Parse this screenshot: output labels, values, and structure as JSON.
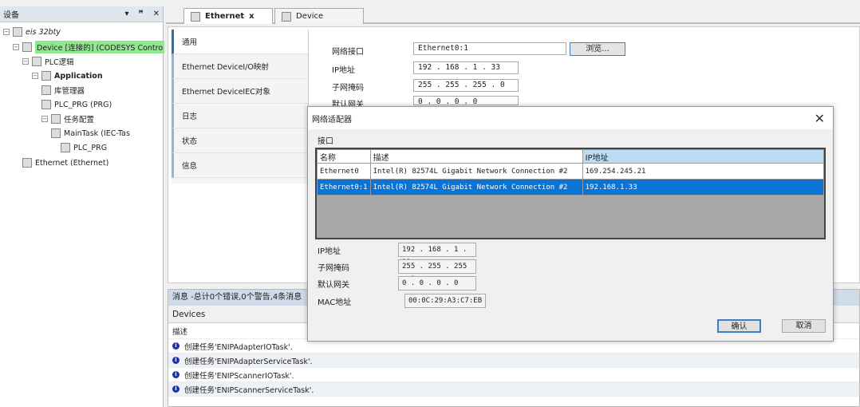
{
  "left_panel": {
    "title": "设备",
    "controls": [
      "▾",
      "ꟸ",
      "✕"
    ],
    "tree": [
      {
        "label": "eis 32bty",
        "icon": "project-icon",
        "level": 0
      },
      {
        "label": "Device [连接的] (CODESYS Contro",
        "icon": "device-icon",
        "level": 1,
        "highlight": "#8fe88f"
      },
      {
        "label": "PLC逻辑",
        "icon": "plc-logic-icon",
        "level": 2
      },
      {
        "label": "Application",
        "icon": "application-icon",
        "level": 3
      },
      {
        "label": "库管理器",
        "icon": "library-icon",
        "level": 4
      },
      {
        "label": "PLC_PRG (PRG)",
        "icon": "program-icon",
        "level": 4
      },
      {
        "label": "任务配置",
        "icon": "task-config-icon",
        "level": 4
      },
      {
        "label": "MainTask (IEC-Tas",
        "icon": "task-icon",
        "level": 5
      },
      {
        "label": "PLC_PRG",
        "icon": "program-call-icon",
        "level": 6
      },
      {
        "label": "Ethernet (Ethernet)",
        "icon": "ethernet-icon",
        "level": 2
      }
    ]
  },
  "tabs": [
    {
      "label": "Ethernet",
      "close": "x"
    },
    {
      "label": "Device"
    }
  ],
  "nav": [
    "通用",
    "Ethernet DeviceI/O映射",
    "Ethernet DeviceIEC对象",
    "日志",
    "状态",
    "信息"
  ],
  "form": {
    "interface_label": "网络接口",
    "interface_value": "Ethernet0:1",
    "browse": "浏览...",
    "ip_label": "IP地址",
    "ip": "192 . 168 . 1 . 33",
    "mask_label": "子网掩码",
    "mask": "255 . 255 . 255 . 0",
    "gw_label": "默认网关",
    "gw": "0 . 0 . 0 . 0"
  },
  "messages": {
    "header": "消息 -总计0个错误,0个警告,4条消息",
    "source": "Devices",
    "column": "描述",
    "rows": [
      "创建任务'ENIPAdapterIOTask'.",
      "创建任务'ENIPAdapterServiceTask'.",
      "创建任务'ENIPScannerIOTask'.",
      "创建任务'ENIPScannerServiceTask'."
    ]
  },
  "dialog": {
    "title": "网络适配器",
    "close": "✕",
    "group": "接口",
    "columns": [
      "名称",
      "描述",
      "IP地址"
    ],
    "rows": [
      [
        "Ethernet0",
        "Intel(R) 82574L Gigabit Network Connection #2",
        "169.254.245.21"
      ],
      [
        "Ethernet0:1",
        "Intel(R) 82574L Gigabit Network Connection #2",
        "192.168.1.33"
      ]
    ],
    "ip_label": "IP地址",
    "ip": "192 . 168 . 1 . 33",
    "mask_label": "子网掩码",
    "mask": "255 . 255 . 255 . 0",
    "gw_label": "默认网关",
    "gw": "0 . 0 . 0 . 0",
    "mac_label": "MAC地址",
    "mac": "00:0C:29:A3:C7:EB",
    "ok": "确认",
    "cancel": "取消"
  }
}
